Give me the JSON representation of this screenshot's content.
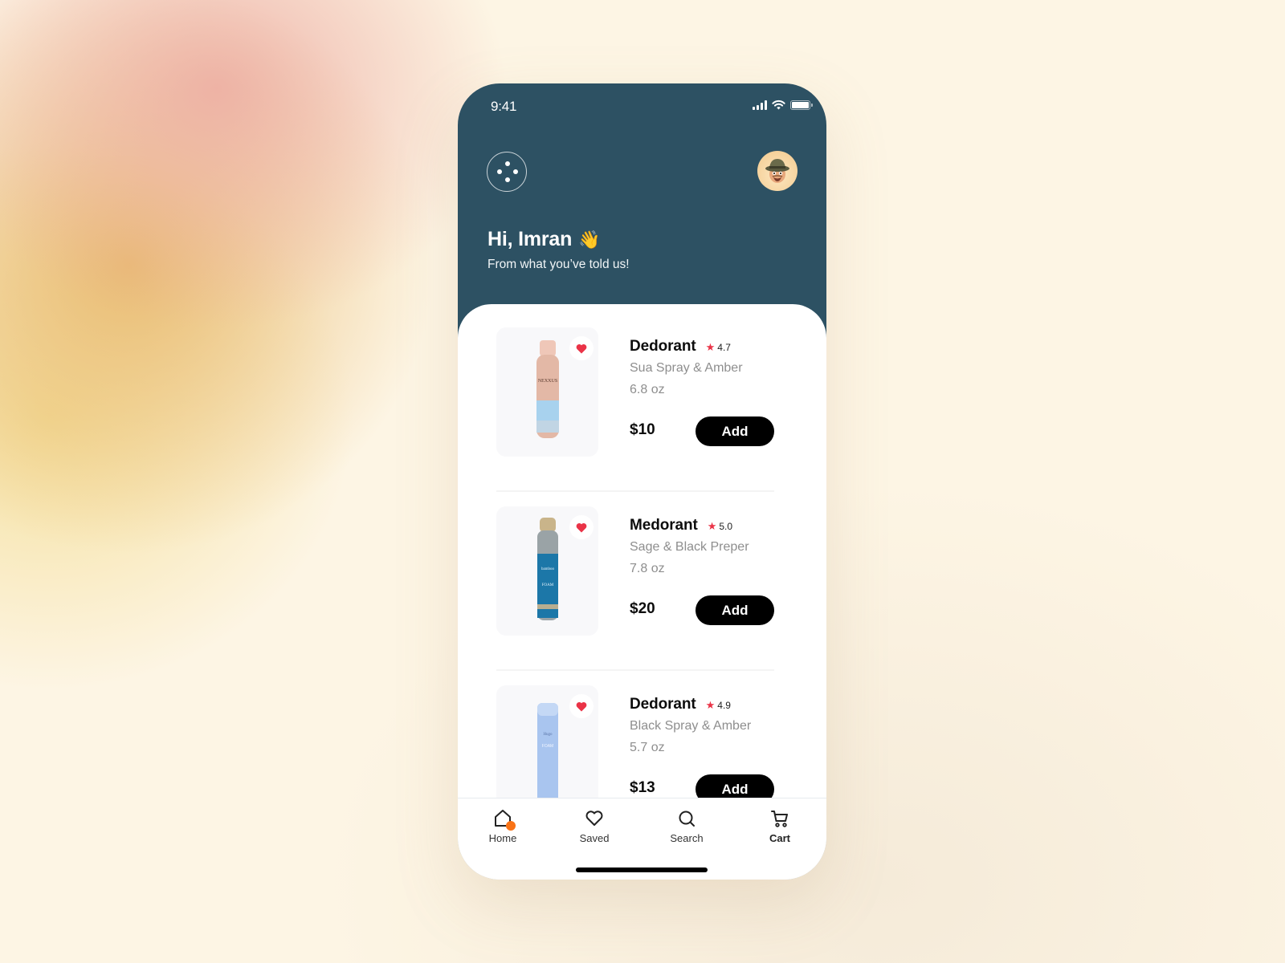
{
  "status_bar": {
    "time": "9:41",
    "icons": [
      "cellular-signal-icon",
      "wifi-icon",
      "battery-icon"
    ]
  },
  "header": {
    "menu_icon": "four-dots-menu-icon",
    "avatar": "user-avatar-memoji",
    "greeting": "Hi, Imran",
    "greeting_emoji": "👋",
    "subtitle": "From what you’ve told us!"
  },
  "products": [
    {
      "name": "Dedorant",
      "rating": "4.7",
      "variant": "Sua Spray & Amber",
      "size": "6.8 oz",
      "price": "$10",
      "add_label": "Add",
      "favorited": true,
      "image_brand": "NEXXUS"
    },
    {
      "name": "Medorant",
      "rating": "5.0",
      "variant": "Sage & Black Preper",
      "size": "7.8 oz",
      "price": "$20",
      "add_label": "Add",
      "favorited": true,
      "image_brand": "FOAM"
    },
    {
      "name": "Dedorant",
      "rating": "4.9",
      "variant": "Black Spray & Amber",
      "size": "5.7 oz",
      "price": "$13",
      "add_label": "Add",
      "favorited": true,
      "image_brand": "FOAM"
    }
  ],
  "tab_bar": {
    "tabs": [
      {
        "label": "Home",
        "icon": "home-icon",
        "active": true,
        "badge_color": "#f97316"
      },
      {
        "label": "Saved",
        "icon": "heart-icon",
        "active": false
      },
      {
        "label": "Search",
        "icon": "search-icon",
        "active": false
      },
      {
        "label": "Cart",
        "icon": "cart-icon",
        "active": false
      }
    ]
  },
  "colors": {
    "header_bg": "#2d5163",
    "star": "#ea3347",
    "heart": "#ea3347",
    "button_bg": "#000000",
    "home_badge": "#f97316"
  }
}
